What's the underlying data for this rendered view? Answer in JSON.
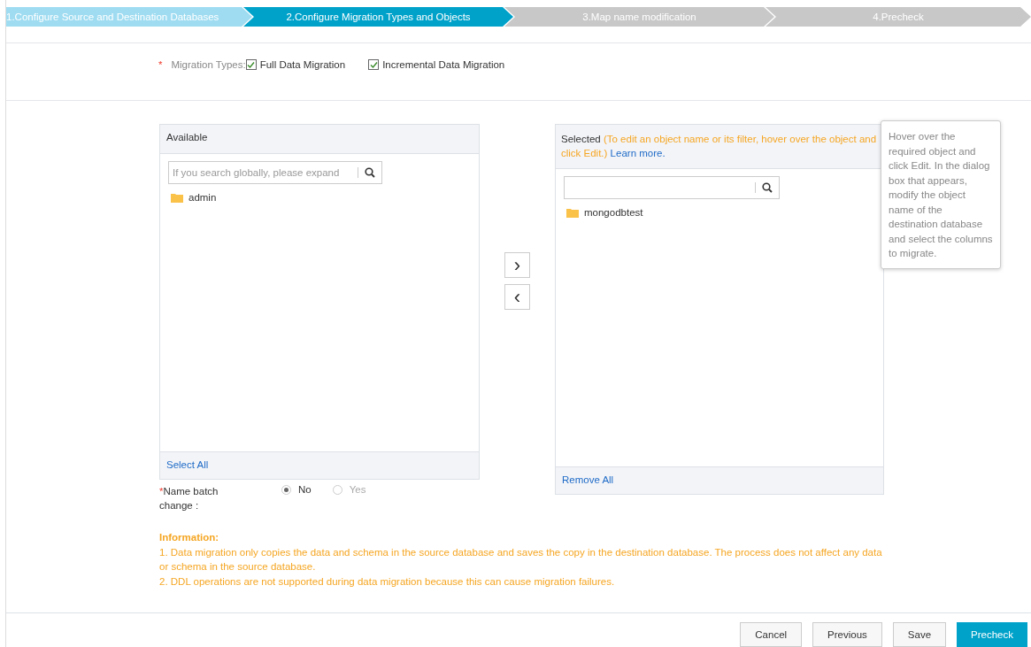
{
  "steps": [
    {
      "label": "1.Configure Source and Destination Databases",
      "completed": true,
      "selected": false
    },
    {
      "label": "2.Configure Migration Types and Objects",
      "completed": false,
      "selected": true
    },
    {
      "label": "3.Map name modification",
      "completed": false,
      "selected": false
    },
    {
      "label": "4.Precheck",
      "completed": false,
      "selected": false
    }
  ],
  "migration_types": {
    "required_mark": "*",
    "label": "Migration Types:",
    "options": [
      {
        "label": "Full Data Migration",
        "checked": true
      },
      {
        "label": "Incremental Data Migration",
        "checked": true
      }
    ]
  },
  "available": {
    "title": "Available",
    "search": {
      "placeholder": "If you search globally, please expand"
    },
    "items": [
      {
        "label": "admin"
      }
    ],
    "footer_link": "Select All"
  },
  "move_buttons": [
    {
      "symbol": "›"
    },
    {
      "symbol": "‹"
    }
  ],
  "selected": {
    "title": "Selected",
    "hint": "(To edit an object name or its filter, hover over the object and click Edit.)",
    "link": "Learn more.",
    "items": [
      {
        "label": "mongodbtest"
      }
    ],
    "footer_link": "Remove All"
  },
  "tooltip": "Hover over the required object and click Edit. In the dialog box that appears, modify the object name of the destination database and select the columns to migrate.",
  "name_batch_change": {
    "required_mark": "*",
    "label": "Name batch change :",
    "options": [
      {
        "label": "No",
        "selected": true,
        "disabled": false
      },
      {
        "label": "Yes",
        "selected": false,
        "disabled": true
      }
    ]
  },
  "information": {
    "title": "Information:",
    "lines": [
      "1. Data migration only copies the data and schema in the source database and saves the copy in the destination database. The process does not affect any data or schema in the source database.",
      "2. DDL operations are not supported during data migration because this can cause migration failures."
    ]
  },
  "buttons": [
    {
      "label": "Cancel",
      "kind": "default"
    },
    {
      "label": "Previous",
      "kind": "default"
    },
    {
      "label": "Save",
      "kind": "default"
    },
    {
      "label": "Precheck",
      "kind": "primary"
    }
  ]
}
